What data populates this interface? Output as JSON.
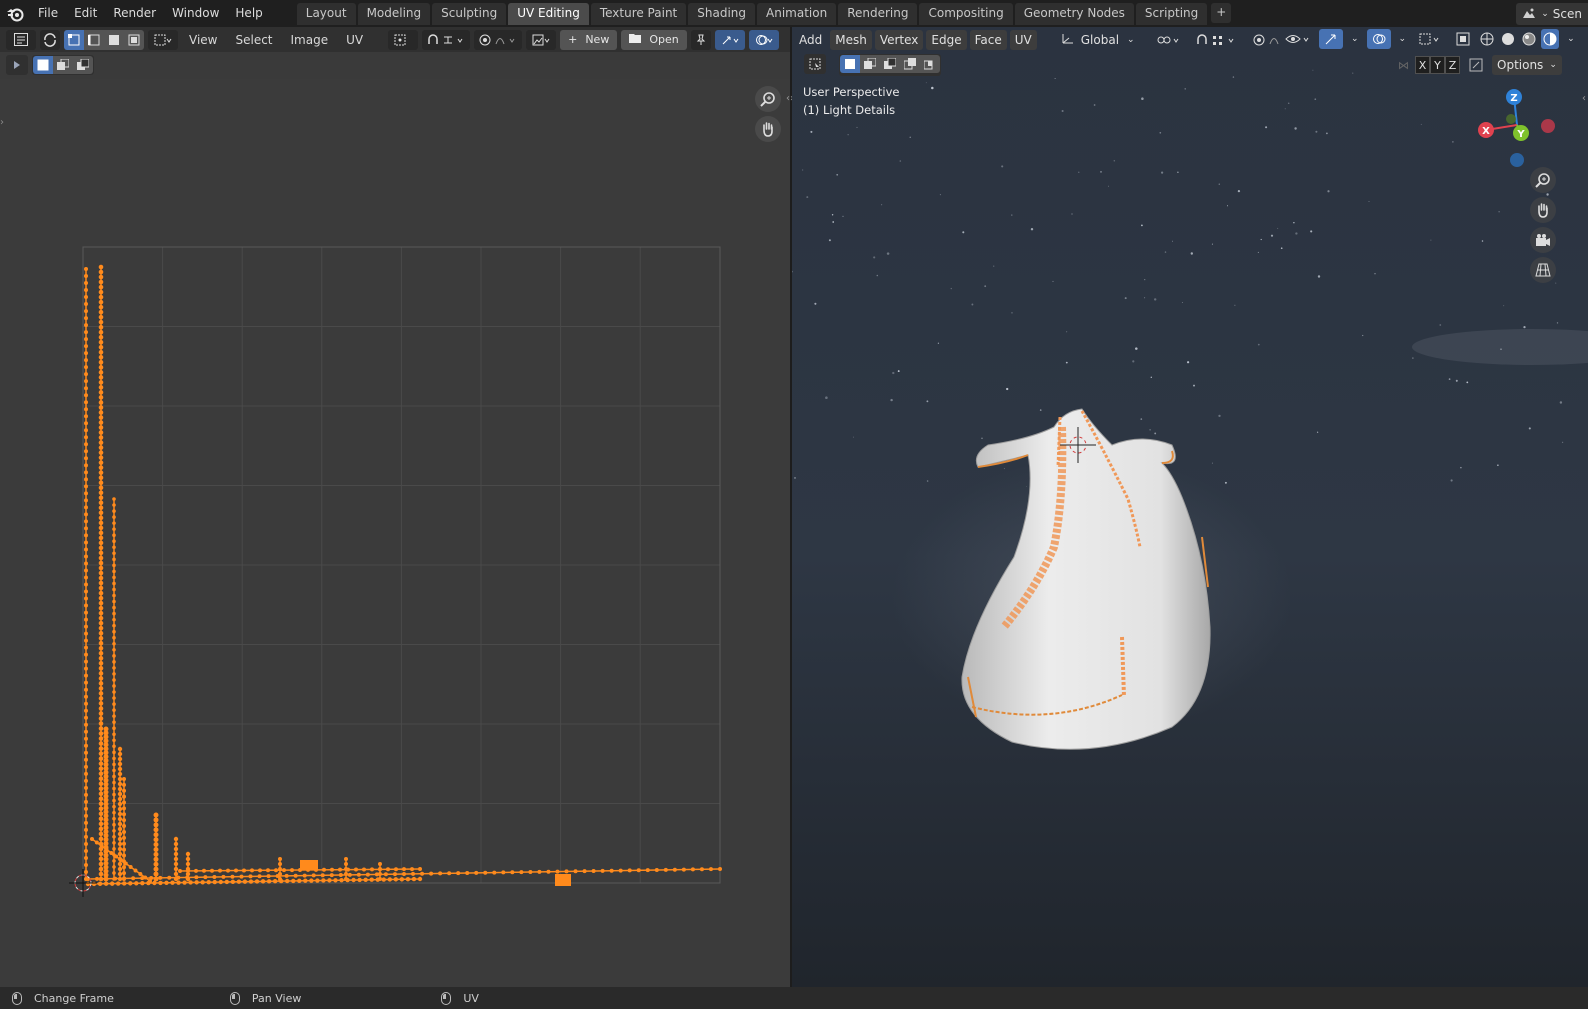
{
  "menu": {
    "items": [
      "File",
      "Edit",
      "Render",
      "Window",
      "Help"
    ]
  },
  "workspaces": {
    "tabs": [
      "Layout",
      "Modeling",
      "Sculpting",
      "UV Editing",
      "Texture Paint",
      "Shading",
      "Animation",
      "Rendering",
      "Compositing",
      "Geometry Nodes",
      "Scripting"
    ],
    "active": "UV Editing",
    "add_label": "+"
  },
  "scene": {
    "label": "Scen"
  },
  "uv_editor": {
    "menus": [
      "View",
      "Select",
      "Image",
      "UV"
    ],
    "new_label": "New",
    "open_label": "Open"
  },
  "viewport": {
    "mode_menus": [
      "Add",
      "Mesh",
      "Vertex",
      "Edge",
      "Face",
      "UV"
    ],
    "transform_orientation": "Global",
    "perspective_label": "User Perspective",
    "object_label": "(1) Light Details",
    "mirror_axes": [
      "X",
      "Y",
      "Z"
    ],
    "options_label": "Options",
    "gizmo_axes": [
      "Z",
      "X",
      "Y"
    ],
    "colors": {
      "accent": "#4772b3",
      "selection": "#ff8c1a",
      "x_axis": "#e0424f",
      "y_axis": "#7fc22c",
      "z_axis": "#2f82d8"
    }
  },
  "statusbar": {
    "items": [
      "Change Frame",
      "Pan View",
      "UV"
    ]
  }
}
